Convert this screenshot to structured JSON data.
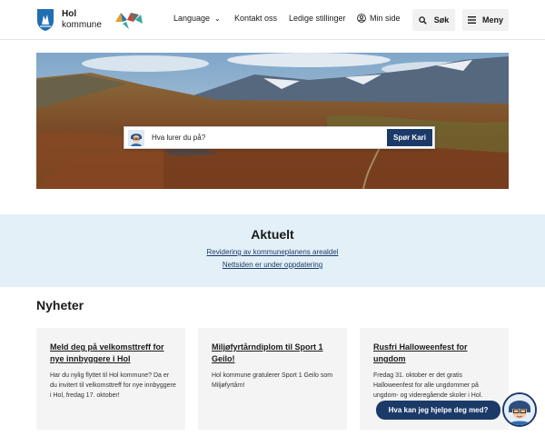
{
  "header": {
    "logo_name": "Hol",
    "logo_sub": "kommune",
    "nav": {
      "language": "Language",
      "contact": "Kontakt oss",
      "jobs": "Ledige stillinger",
      "mypage": "Min side"
    },
    "search_label": "Søk",
    "menu_label": "Meny"
  },
  "hero": {
    "ask_placeholder": "Hva lurer du på?",
    "ask_button": "Spør Kari"
  },
  "aktuelt": {
    "title": "Aktuelt",
    "links": [
      "Revidering av kommuneplanens arealdel",
      "Nettsiden er under oppdatering"
    ]
  },
  "nyheter": {
    "title": "Nyheter",
    "cards": [
      {
        "title": "Meld deg på velkomsttreff for nye innbyggere i Hol",
        "body": "Har du nylig flyttet til Hol kommune? Da er du invitert til velkomsttreff for nye innbyggere i Hol, fredag 17. oktober!"
      },
      {
        "title": "Miljøfyrtårndiplom til Sport 1 Geilo!",
        "body": "Hol kommune gratulerer Sport 1 Geilo som Miljøfyrtårn!"
      },
      {
        "title": "Rusfri Halloweenfest for ungdom",
        "body": "Fredag 31. oktober er det gratis Halloweenfest for alle ungdommer på ungdom- og videregående skoler i Hol."
      }
    ]
  },
  "chat": {
    "prompt": "Hva kan jeg hjelpe deg med?"
  },
  "colors": {
    "brand_navy": "#1c3a67",
    "shield_blue": "#1f6fb2",
    "news_band": "#e3f0f8"
  }
}
